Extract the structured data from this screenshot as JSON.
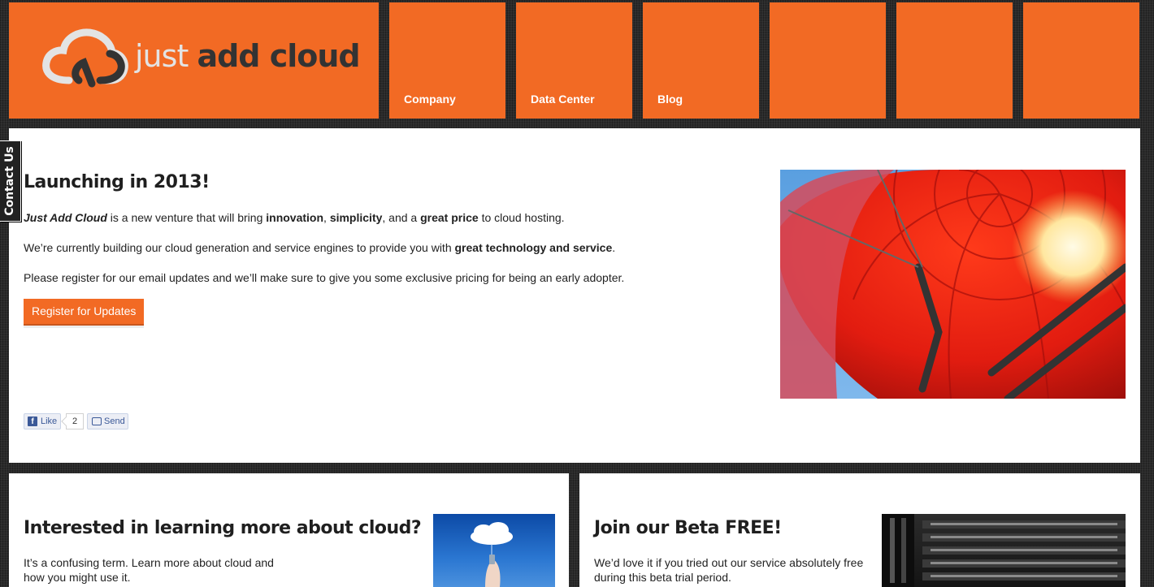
{
  "brand": {
    "logo_just": "just",
    "logo_rest": "add cloud"
  },
  "nav": {
    "items": [
      {
        "label": "Company"
      },
      {
        "label": "Data Center"
      },
      {
        "label": "Blog"
      },
      {
        "label": ""
      },
      {
        "label": ""
      },
      {
        "label": ""
      }
    ]
  },
  "contact_tab": {
    "label": "Contact Us"
  },
  "hero": {
    "title": "Launching in 2013!",
    "p1": {
      "brand": "Just Add Cloud",
      "t1": " is a new venture that will bring ",
      "b1": "innovation",
      "t2": ", ",
      "b2": "simplicity",
      "t3": ", and a ",
      "b3": "great price",
      "t4": " to cloud hosting."
    },
    "p2": {
      "t1": "We’re currently building our cloud generation and service engines to provide you with ",
      "b1": "great technology and service",
      "t2": "."
    },
    "p3": "Please register for our email updates and we’ll make sure to give you some exclusive pricing for being an early adopter.",
    "register_label": "Register for Updates",
    "social": {
      "like_label": "Like",
      "like_count": "2",
      "send_label": "Send"
    }
  },
  "cards": {
    "left": {
      "title": "Interested in learning more about cloud?",
      "text": "It’s a confusing term. Learn more about cloud and how you might use it."
    },
    "right": {
      "title": "Join our Beta FREE!",
      "text": "We’d love it if you tried out our service absolutely free during this beta trial period."
    }
  },
  "colors": {
    "accent": "#f26a24",
    "background": "#2b2b2b",
    "panel": "#ffffff"
  },
  "icons": [
    "cloud-logo-icon",
    "facebook-icon",
    "send-icon"
  ]
}
